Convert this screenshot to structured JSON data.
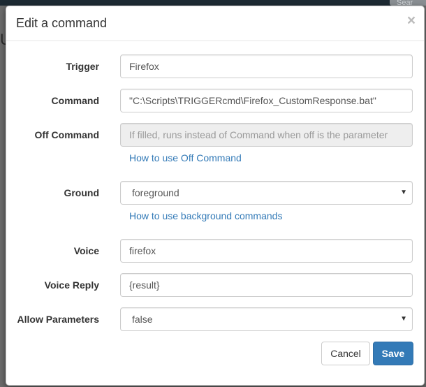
{
  "background": {
    "search_text": "Sear"
  },
  "dialog": {
    "title": "Edit a command",
    "close_glyph": "×"
  },
  "form": {
    "trigger": {
      "label": "Trigger",
      "value": "Firefox"
    },
    "command": {
      "label": "Command",
      "value": "\"C:\\Scripts\\TRIGGERcmd\\Firefox_CustomResponse.bat\""
    },
    "off_command": {
      "label": "Off Command",
      "value": "",
      "placeholder": "If filled, runs instead of Command when off is the parameter",
      "help_link": "How to use Off Command"
    },
    "ground": {
      "label": "Ground",
      "selected": "foreground",
      "help_link": "How to use background commands"
    },
    "voice": {
      "label": "Voice",
      "value": "firefox"
    },
    "voice_reply": {
      "label": "Voice Reply",
      "value": "{result}"
    },
    "allow_parameters": {
      "label": "Allow Parameters",
      "selected": "false"
    }
  },
  "footer": {
    "cancel_label": "Cancel",
    "save_label": "Save"
  },
  "colors": {
    "primary": "#337ab7",
    "link": "#337ab7",
    "disabled_bg": "#eeeeee",
    "backdrop": "#6b6b6b"
  },
  "icons": {
    "close": "close-icon",
    "select_caret": "caret-down-icon"
  }
}
